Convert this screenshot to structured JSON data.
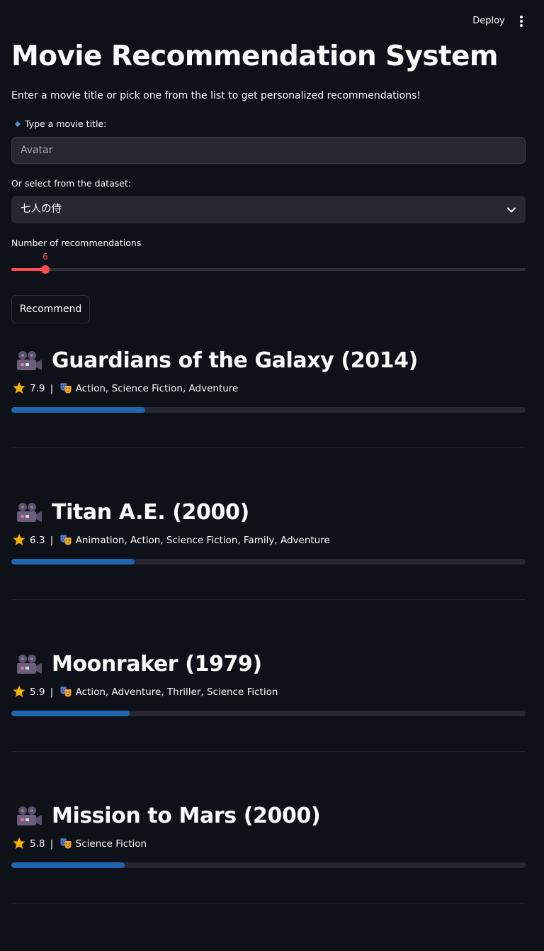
{
  "header": {
    "deploy_label": "Deploy",
    "menu_icon": "vertical-ellipsis-icon"
  },
  "main": {
    "title": "Movie Recommendation System",
    "intro": "Enter a movie title or pick one from the list to get personalized recommendations!",
    "title_input": {
      "label": "Type a movie title:",
      "label_icon": "blue-diamond-icon",
      "value": "Avatar"
    },
    "dataset_select": {
      "label": "Or select from the dataset:",
      "selected": "七人の侍"
    },
    "count_slider": {
      "label": "Number of recommendations",
      "value": "6",
      "fraction": 0.066
    },
    "recommend_label": "Recommend"
  },
  "recommendations": [
    {
      "title": "Guardians of the Galaxy (2014)",
      "rating": "7.9",
      "separator": "|",
      "genres": "Action, Science Fiction, Adventure",
      "score_fraction": 0.26
    },
    {
      "title": "Titan A.E. (2000)",
      "rating": "6.3",
      "separator": "|",
      "genres": "Animation, Action, Science Fiction, Family, Adventure",
      "score_fraction": 0.24
    },
    {
      "title": "Moonraker (1979)",
      "rating": "5.9",
      "separator": "|",
      "genres": "Action, Adventure, Thriller, Science Fiction",
      "score_fraction": 0.23
    },
    {
      "title": "Mission to Mars (2000)",
      "rating": "5.8",
      "separator": "|",
      "genres": "Science Fiction",
      "score_fraction": 0.22
    }
  ],
  "colors": {
    "background": "#0e1117",
    "accent": "#ff4b4b",
    "progress": "#1f65b0"
  },
  "icons": {
    "card_icon": "movie-camera-icon",
    "rating_icon": "star-icon",
    "genre_icon": "performing-arts-mask-icon"
  }
}
